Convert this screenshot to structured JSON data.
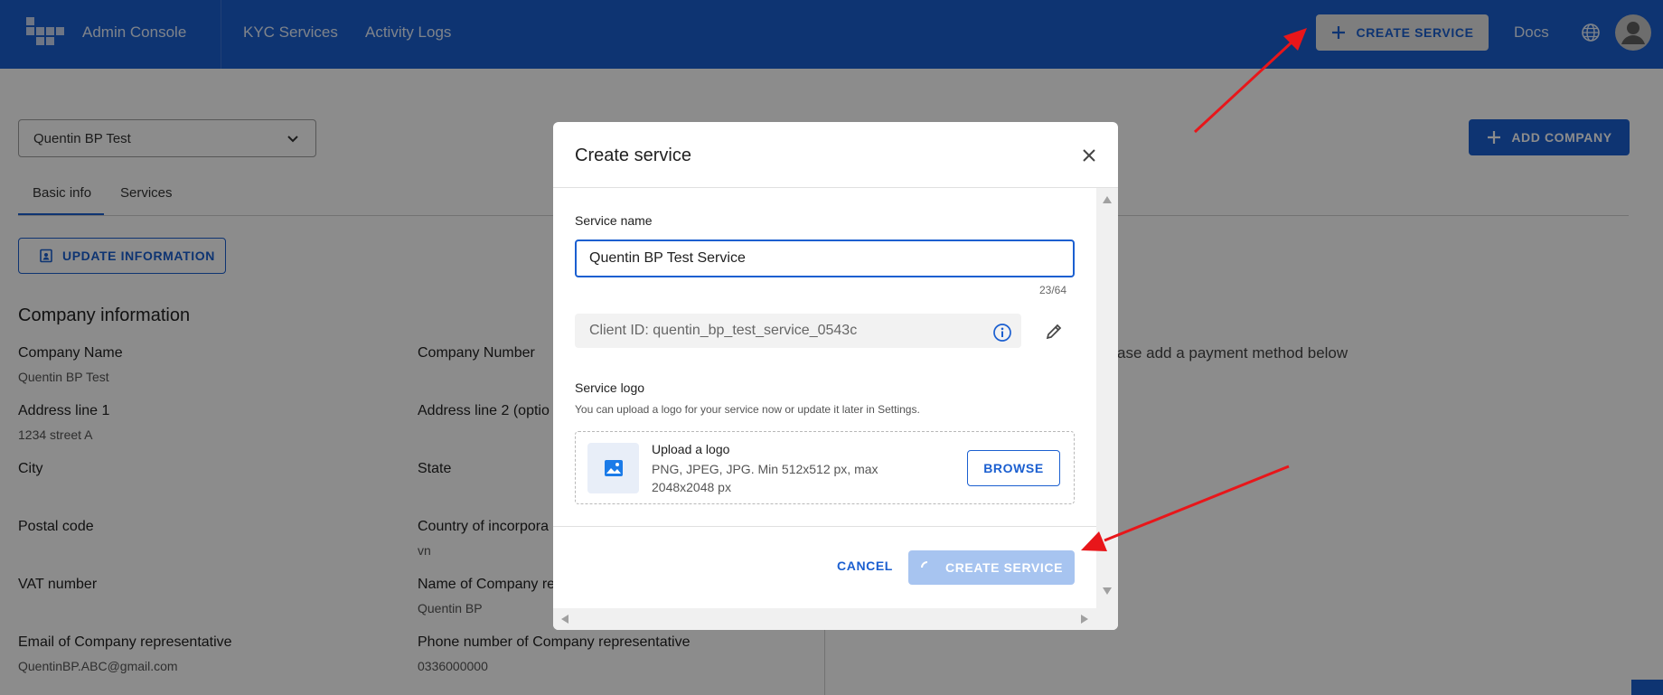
{
  "topbar": {
    "app_title": "Admin Console",
    "nav": [
      "KYC Services",
      "Activity Logs"
    ],
    "create_service_label": "CREATE SERVICE",
    "docs_label": "Docs",
    "globe_icon": "globe-icon",
    "avatar_icon": "person-icon",
    "brand_color": "#1b5fd0"
  },
  "page": {
    "company_select_value": "Quentin BP Test",
    "tabs": [
      "Basic info",
      "Services"
    ],
    "active_tab": "Basic info",
    "update_button_label": "UPDATE INFORMATION",
    "add_company_label": "ADD COMPANY",
    "section_title": "Company information",
    "fields": [
      {
        "label": "Company Name",
        "value": "Quentin BP Test"
      },
      {
        "label": "Company Number",
        "value": ""
      },
      {
        "label": "Address line 1",
        "value": "1234 street A"
      },
      {
        "label": "Address line 2 (optio",
        "value": ""
      },
      {
        "label": "City",
        "value": ""
      },
      {
        "label": "State",
        "value": ""
      },
      {
        "label": "Postal code",
        "value": ""
      },
      {
        "label": "Country of incorpora",
        "value": "vn"
      },
      {
        "label": "VAT number",
        "value": ""
      },
      {
        "label": "Name of Company re",
        "value": "Quentin BP"
      },
      {
        "label": "Email of Company representative",
        "value": "QuentinBP.ABC@gmail.com"
      },
      {
        "label": "Phone number of Company representative",
        "value": "0336000000"
      }
    ],
    "payment_hint": "ase add a payment method below"
  },
  "modal": {
    "title": "Create service",
    "service_name_label": "Service name",
    "service_name_value": "Quentin BP Test Service",
    "char_counter": "23/64",
    "client_id": "Client ID: quentin_bp_test_service_0543c",
    "logo_label": "Service logo",
    "logo_hint": "You can upload a logo for your service now or update it later in Settings.",
    "upload_title": "Upload a logo",
    "upload_desc": "PNG, JPEG, JPG. Min 512x512 px, max 2048x2048 px",
    "browse_label": "BROWSE",
    "cancel_label": "CANCEL",
    "create_label": "CREATE SERVICE"
  },
  "colors": {
    "accent": "#1b5fd0",
    "disabled_button": "#a7c4f0",
    "annotation_arrow": "#e8161a"
  }
}
